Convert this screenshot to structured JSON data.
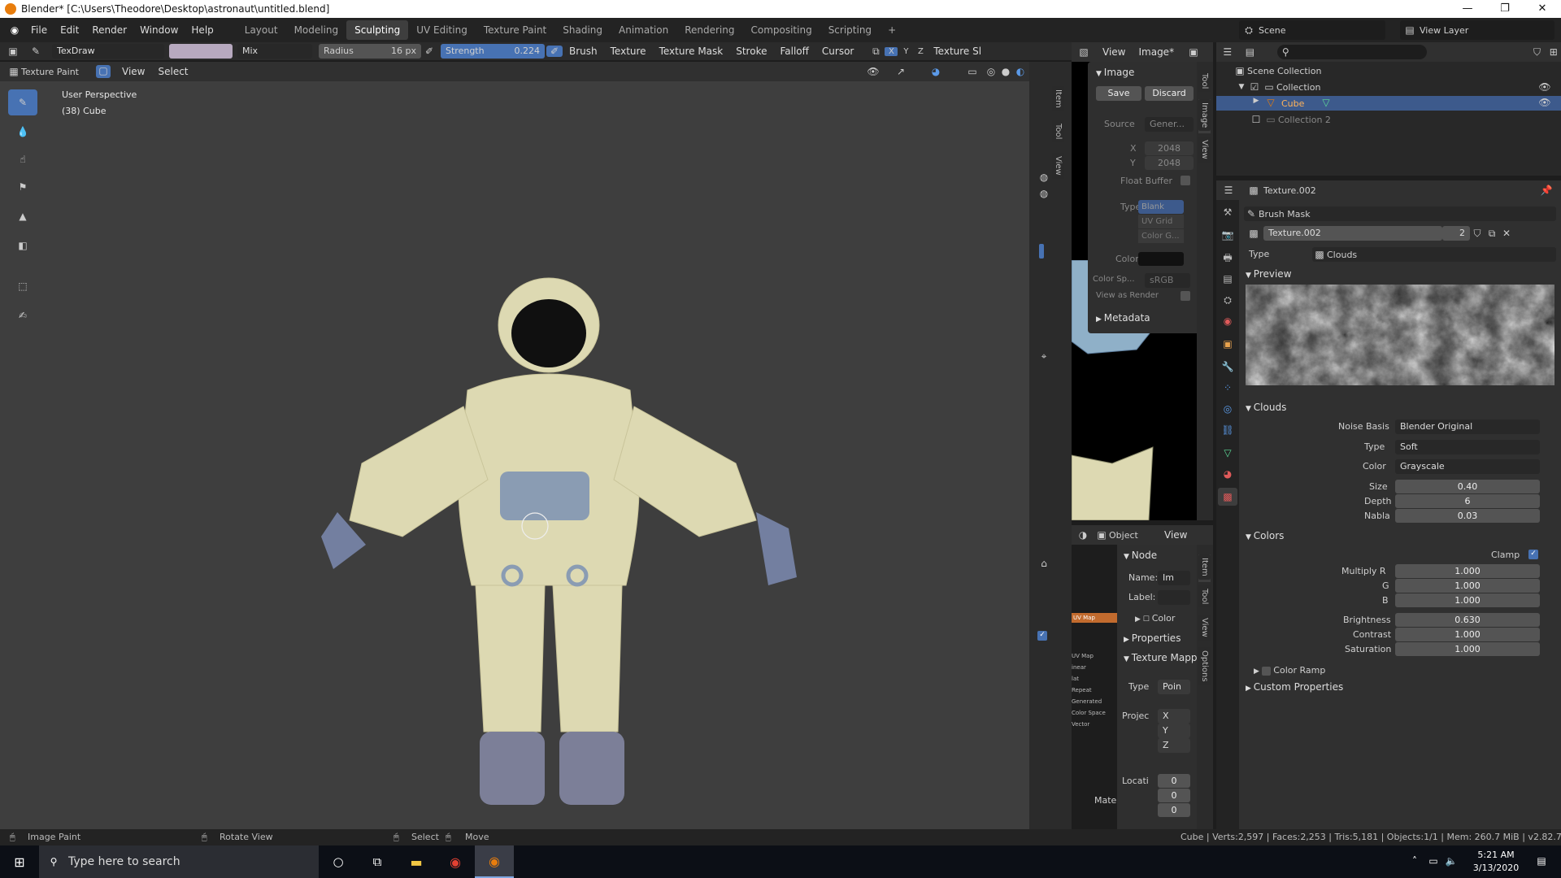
{
  "window": {
    "title": "Blender* [C:\\Users\\Theodore\\Desktop\\astronaut\\untitled.blend]",
    "min": "—",
    "max": "❐",
    "close": "✕"
  },
  "menu": {
    "file": "File",
    "edit": "Edit",
    "render": "Render",
    "window": "Window",
    "help": "Help"
  },
  "workspaces": [
    "Layout",
    "Modeling",
    "Sculpting",
    "UV Editing",
    "Texture Paint",
    "Shading",
    "Animation",
    "Rendering",
    "Compositing",
    "Scripting"
  ],
  "workspace_add": "+",
  "scene": {
    "name": "Scene",
    "view_layer": "View Layer"
  },
  "toolbar": {
    "brush_name": "TexDraw",
    "blend": "Mix",
    "radius_label": "Radius",
    "radius_value": "16 px",
    "strength_label": "Strength",
    "strength_value": "0.224",
    "brush": "Brush",
    "texture": "Texture",
    "texture_mask": "Texture Mask",
    "stroke": "Stroke",
    "falloff": "Falloff",
    "cursor": "Cursor",
    "x": "X",
    "y": "Y",
    "z": "Z",
    "texture_slots": "Texture Slots"
  },
  "viewport": {
    "mode": "Texture Paint",
    "view": "View",
    "select": "Select",
    "perspective": "User Perspective",
    "object": "(38) Cube"
  },
  "image_editor": {
    "view": "View",
    "image": "Image*",
    "panel_title": "Image",
    "save": "Save",
    "discard": "Discard",
    "source_label": "Source",
    "source_value": "Gener...",
    "x_label": "X",
    "x_value": "2048",
    "y_label": "Y",
    "y_value": "2048",
    "float_buffer": "Float Buffer",
    "type_label": "Type",
    "types": [
      "Blank",
      "UV Grid",
      "Color G..."
    ],
    "color_label": "Color",
    "colorspace_label": "Color Sp...",
    "colorspace_value": "sRGB",
    "view_as_render": "View as Render",
    "metadata": "Metadata",
    "tabs": [
      "Tool",
      "Image",
      "View"
    ]
  },
  "node_editor": {
    "object": "Object",
    "view": "View",
    "node_panel": "Node",
    "name_label": "Name:",
    "name_value": "Im",
    "label_label": "Label:",
    "color": "Color",
    "properties": "Properties",
    "texture_mapping": "Texture Mapp",
    "type_label": "Type",
    "type_value": "Poin",
    "projection_label": "Projec",
    "proj_x": "X",
    "proj_y": "Y",
    "proj_z": "Z",
    "location_label": "Locati",
    "loc_x": "0",
    "loc_y": "0",
    "loc_z": "0",
    "mate": "Mate",
    "tabs": [
      "Item",
      "Tool",
      "View",
      "Options"
    ],
    "side_tabs": [
      "Item",
      "Tool",
      "View"
    ],
    "node_items": [
      "UV Map",
      "UV Map",
      "inear",
      "lat",
      "Repeat",
      "Generated",
      "Color Space",
      "Vector"
    ]
  },
  "outliner": {
    "scene_collection": "Scene Collection",
    "collection": "Collection",
    "cube": "Cube",
    "collection2": "Collection 2"
  },
  "properties": {
    "texture_name": "Texture.002",
    "brush_mask": "Brush Mask",
    "texture_field": "Texture.002",
    "users": "2",
    "type_label": "Type",
    "type_value": "Clouds",
    "preview": "Preview",
    "clouds": "Clouds",
    "noise_basis_label": "Noise Basis",
    "noise_basis_value": "Blender Original",
    "ctype_label": "Type",
    "ctype_value": "Soft",
    "color_label": "Color",
    "color_value": "Grayscale",
    "size_label": "Size",
    "size_value": "0.40",
    "depth_label": "Depth",
    "depth_value": "6",
    "nabla_label": "Nabla",
    "nabla_value": "0.03",
    "colors": "Colors",
    "clamp": "Clamp",
    "multiply_r_label": "Multiply R",
    "multiply_r": "1.000",
    "g_label": "G",
    "g": "1.000",
    "b_label": "B",
    "b": "1.000",
    "brightness_label": "Brightness",
    "brightness": "0.630",
    "contrast_label": "Contrast",
    "contrast": "1.000",
    "saturation_label": "Saturation",
    "saturation": "1.000",
    "color_ramp": "Color Ramp",
    "custom_properties": "Custom Properties"
  },
  "statusbar": {
    "image_paint": "Image Paint",
    "rotate_view": "Rotate View",
    "select": "Select",
    "move": "Move",
    "stats": "Cube | Verts:2,597 | Faces:2,253 | Tris:5,181 | Objects:1/1 | Mem: 260.7 MiB | v2.82.7"
  },
  "taskbar": {
    "search_placeholder": "Type here to search",
    "time": "5:21 AM",
    "date": "3/13/2020"
  },
  "colors": {
    "accent": "#4772b3",
    "blender_orange": "#e87d0d",
    "active_blue": "#3d5a8c"
  }
}
